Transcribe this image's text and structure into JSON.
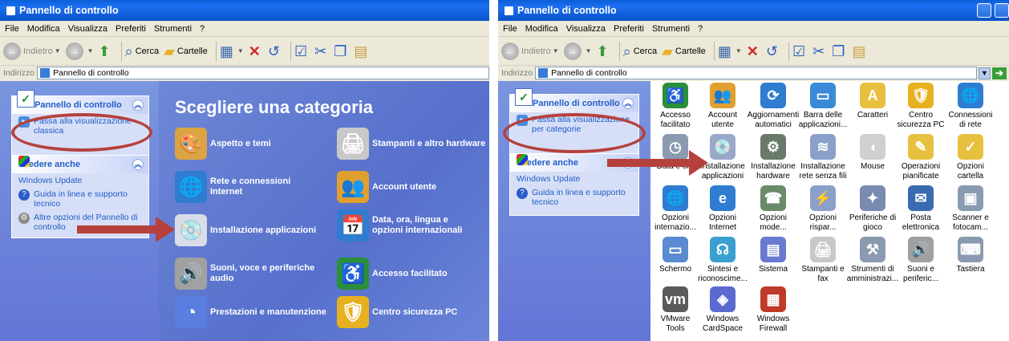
{
  "left_window": {
    "title": "Pannello di controllo",
    "menu": [
      "File",
      "Modifica",
      "Visualizza",
      "Preferiti",
      "Strumenti",
      "?"
    ],
    "toolbar": {
      "back": "Indietro",
      "search": "Cerca",
      "folders": "Cartelle"
    },
    "address": {
      "label": "Indirizzo",
      "value": "Pannello di controllo"
    },
    "sidebar": {
      "panel_title": "Pannello di controllo",
      "switch_view": "Passa alla visualizzazione classica",
      "see_also_title": "Vedere anche",
      "see_also": [
        "Windows Update",
        "Guida in linea e supporto tecnico",
        "Altre opzioni del Pannello di controllo"
      ]
    },
    "heading": "Scegliere una categoria",
    "categories": [
      {
        "label": "Aspetto e temi",
        "icon": "appearance-icon",
        "color": "#d9a441"
      },
      {
        "label": "Stampanti e altro hardware",
        "icon": "printer-icon",
        "color": "#c8c8c8"
      },
      {
        "label": "Rete e connessioni Internet",
        "icon": "globe-icon",
        "color": "#2e7dd1"
      },
      {
        "label": "Account utente",
        "icon": "users-icon",
        "color": "#e0a030"
      },
      {
        "label": "Installazione applicazioni",
        "icon": "install-icon",
        "color": "#d8dde8"
      },
      {
        "label": "Data, ora, lingua e opzioni internazionali",
        "icon": "globe-calendar-icon",
        "color": "#2e7dd1"
      },
      {
        "label": "Suoni, voce e periferiche audio",
        "icon": "speaker-icon",
        "color": "#a0a0a0"
      },
      {
        "label": "Accesso facilitato",
        "icon": "accessibility-icon",
        "color": "#2a8f3a"
      },
      {
        "label": "Prestazioni e manutenzione",
        "icon": "chart-icon",
        "color": "#5a7ee0"
      },
      {
        "label": "Centro sicurezza PC",
        "icon": "shield-icon",
        "color": "#e6b020"
      }
    ]
  },
  "right_window": {
    "title": "Pannello di controllo",
    "menu": [
      "File",
      "Modifica",
      "Visualizza",
      "Preferiti",
      "Strumenti",
      "?"
    ],
    "toolbar": {
      "back": "Indietro",
      "search": "Cerca",
      "folders": "Cartelle"
    },
    "address": {
      "label": "Indirizzo",
      "value": "Pannello di controllo"
    },
    "sidebar": {
      "panel_title": "Pannello di controllo",
      "switch_view": "Passa alla visualizzazione per categorie",
      "see_also_title": "Vedere anche",
      "see_also": [
        "Windows Update",
        "Guida in linea e supporto tecnico"
      ]
    },
    "icons": [
      {
        "label": "Accesso facilitato",
        "icon": "accessibility-icon",
        "color": "#2a8f3a"
      },
      {
        "label": "Account utente",
        "icon": "users-icon",
        "color": "#e0a030"
      },
      {
        "label": "Aggiornamenti automatici",
        "icon": "update-icon",
        "color": "#2e7dd1"
      },
      {
        "label": "Barra delle applicazioni...",
        "icon": "taskbar-icon",
        "color": "#3a8ad8"
      },
      {
        "label": "Caratteri",
        "icon": "fonts-icon",
        "color": "#e8c040"
      },
      {
        "label": "Centro sicurezza PC",
        "icon": "shield-icon",
        "color": "#e6b020"
      },
      {
        "label": "Connessioni di rete",
        "icon": "network-icon",
        "color": "#2e7dd1"
      },
      {
        "label": "Data e ora",
        "icon": "clock-icon",
        "color": "#8a9ab0"
      },
      {
        "label": "Installazione applicazioni",
        "icon": "install-icon",
        "color": "#9aa8c8"
      },
      {
        "label": "Installazione hardware",
        "icon": "hardware-icon",
        "color": "#6a7a6a"
      },
      {
        "label": "Installazione rete senza fili",
        "icon": "wireless-icon",
        "color": "#8aa0c8"
      },
      {
        "label": "Mouse",
        "icon": "mouse-icon",
        "color": "#d0d0d0"
      },
      {
        "label": "Operazioni pianificate",
        "icon": "tasks-icon",
        "color": "#e8c040"
      },
      {
        "label": "Opzioni cartella",
        "icon": "folder-options-icon",
        "color": "#e8c040"
      },
      {
        "label": "Opzioni internazio...",
        "icon": "globe-icon",
        "color": "#2e7dd1"
      },
      {
        "label": "Opzioni Internet",
        "icon": "ie-icon",
        "color": "#2e7dd1"
      },
      {
        "label": "Opzioni mode...",
        "icon": "modem-icon",
        "color": "#6a8a6a"
      },
      {
        "label": "Opzioni rispar...",
        "icon": "power-icon",
        "color": "#8aa0c8"
      },
      {
        "label": "Periferiche di gioco",
        "icon": "gamepad-icon",
        "color": "#7a8ab0"
      },
      {
        "label": "Posta elettronica",
        "icon": "mail-icon",
        "color": "#3a6ab0"
      },
      {
        "label": "Scanner e fotocam...",
        "icon": "scanner-icon",
        "color": "#8a9ab0"
      },
      {
        "label": "Schermo",
        "icon": "display-icon",
        "color": "#5a8ad0"
      },
      {
        "label": "Sintesi e riconoscime...",
        "icon": "speech-icon",
        "color": "#3aa0d0"
      },
      {
        "label": "Sistema",
        "icon": "system-icon",
        "color": "#6a7ad0"
      },
      {
        "label": "Stampanti e fax",
        "icon": "printer-icon",
        "color": "#c8c8c8"
      },
      {
        "label": "Strumenti di amministrazi...",
        "icon": "admin-tools-icon",
        "color": "#8a9ab0"
      },
      {
        "label": "Suoni e periferic...",
        "icon": "speaker-icon",
        "color": "#a0a0a0"
      },
      {
        "label": "Tastiera",
        "icon": "keyboard-icon",
        "color": "#8a9ab0"
      },
      {
        "label": "VMware Tools",
        "icon": "vmware-icon",
        "color": "#5a5a5a"
      },
      {
        "label": "Windows CardSpace",
        "icon": "cardspace-icon",
        "color": "#5a6ad0"
      },
      {
        "label": "Windows Firewall",
        "icon": "firewall-icon",
        "color": "#c03a2a"
      }
    ]
  }
}
